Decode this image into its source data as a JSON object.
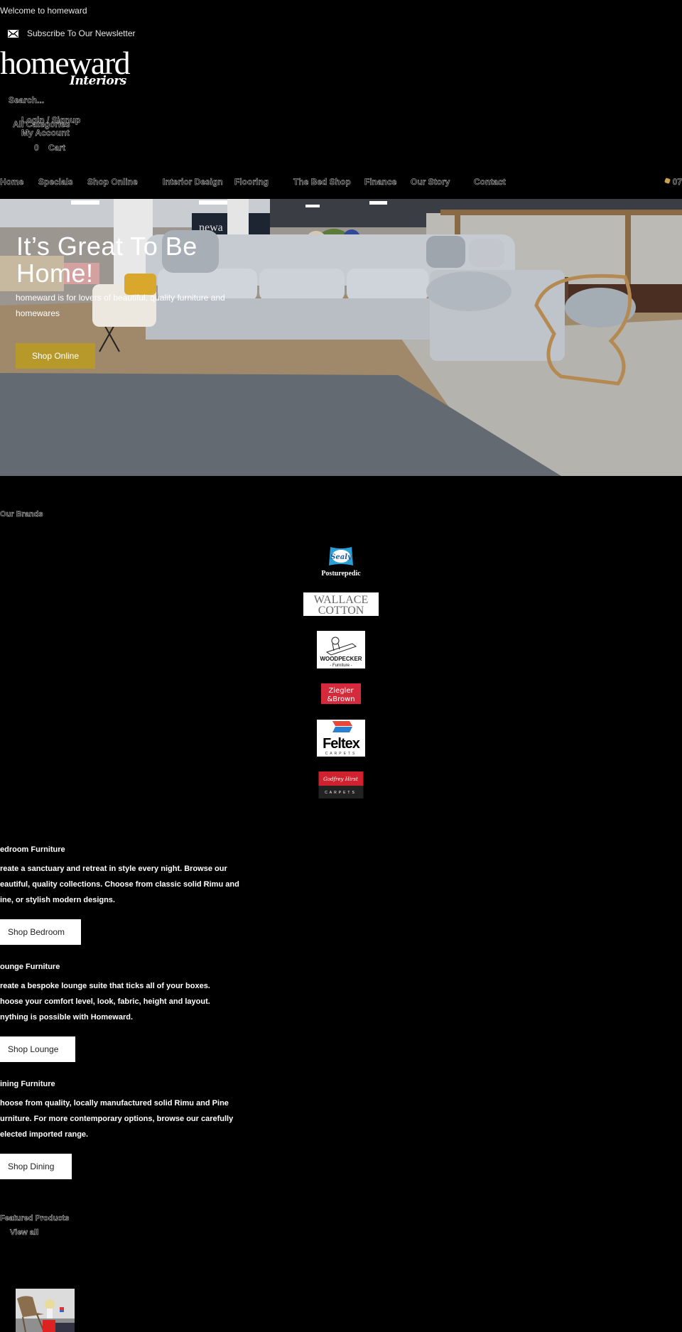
{
  "topbar": {
    "welcome": "Welcome to homeward",
    "newsletter_label": "Subscribe To Our Newsletter",
    "newsletter_icon": "mail-icon"
  },
  "logo": {
    "word": "homeward",
    "sub": "Interiors"
  },
  "header": {
    "search_placeholder": "Search...",
    "categories_label": "All Categories",
    "login_label": "Login / Signup",
    "account_label": "My Account",
    "cart_count": "0",
    "cart_label": "Cart"
  },
  "nav": {
    "items": [
      {
        "label": "Home"
      },
      {
        "label": "Specials"
      },
      {
        "label": "Shop Online"
      },
      {
        "label": "Interior Design"
      },
      {
        "label": "Flooring"
      },
      {
        "label": "The Bed Shop"
      },
      {
        "label": "Finance"
      },
      {
        "label": "Our Story"
      },
      {
        "label": "Contact"
      }
    ],
    "phone_icon": "phone-icon",
    "phone": "07"
  },
  "hero": {
    "title": "It’s Great To Be Home!",
    "subtitle": "homeward is for lovers of beautiful, quality furniture and homewares",
    "button_label": "Shop Online",
    "button_color": "#b7982b"
  },
  "brands": {
    "title": "Our Brands",
    "items": [
      {
        "name": "Sealy Posturepedic",
        "line1": "Sealy",
        "line2": "Posturepedic"
      },
      {
        "name": "Wallace Cotton",
        "line1": "WALLACE",
        "line2": "COTTON"
      },
      {
        "name": "Woodpecker Furniture",
        "line1": "WOODPECKER",
        "line2": "- Furniture -"
      },
      {
        "name": "Ziegler & Brown",
        "line1": "Ziegler",
        "line2": "&Brown"
      },
      {
        "name": "Feltex Carpets",
        "line1": "Feltex",
        "line2": "CARPETS"
      },
      {
        "name": "Godfrey Hirst Carpets",
        "line1": "Godfrey Hirst",
        "line2": "CARPETS"
      }
    ]
  },
  "categories": [
    {
      "title": "edroom Furniture",
      "lines": [
        "reate a sanctuary and retreat in style every night. Browse our",
        "eautiful, quality collections. Choose from classic solid Rimu and",
        "ine, or stylish modern designs."
      ],
      "button_label": "Shop Bedroom"
    },
    {
      "title": "ounge Furniture",
      "lines": [
        "reate a bespoke lounge suite that ticks all of your boxes.",
        "hoose your comfort level, look, fabric, height and layout.",
        "nything is possible with Homeward."
      ],
      "button_label": "Shop Lounge"
    },
    {
      "title": "ining Furniture",
      "lines": [
        "hoose from quality, locally manufactured solid Rimu and Pine",
        "urniture. For more contemporary options, browse our carefully",
        "elected imported range."
      ],
      "button_label": "Shop Dining"
    }
  ],
  "featured": {
    "title": "Featured Products",
    "view_all": "View all"
  }
}
